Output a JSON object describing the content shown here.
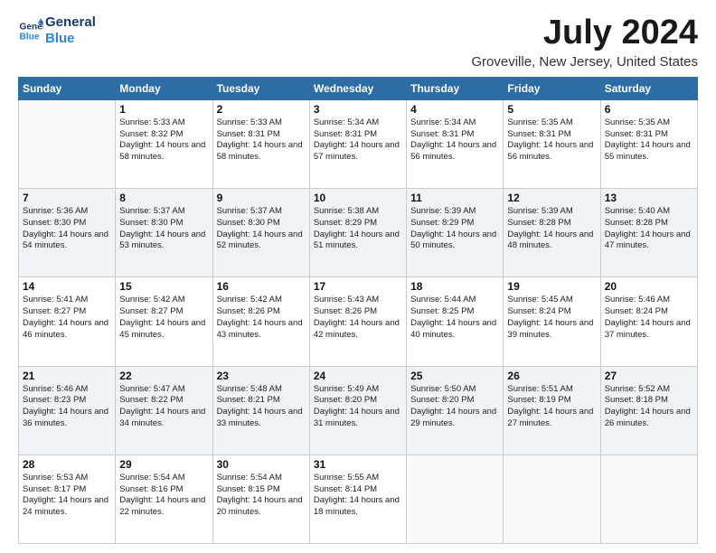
{
  "logo": {
    "line1": "General",
    "line2": "Blue"
  },
  "title": "July 2024",
  "location": "Groveville, New Jersey, United States",
  "weekdays": [
    "Sunday",
    "Monday",
    "Tuesday",
    "Wednesday",
    "Thursday",
    "Friday",
    "Saturday"
  ],
  "weeks": [
    [
      {
        "day": "",
        "sunrise": "",
        "sunset": "",
        "daylight": ""
      },
      {
        "day": "1",
        "sunrise": "Sunrise: 5:33 AM",
        "sunset": "Sunset: 8:32 PM",
        "daylight": "Daylight: 14 hours and 58 minutes."
      },
      {
        "day": "2",
        "sunrise": "Sunrise: 5:33 AM",
        "sunset": "Sunset: 8:31 PM",
        "daylight": "Daylight: 14 hours and 58 minutes."
      },
      {
        "day": "3",
        "sunrise": "Sunrise: 5:34 AM",
        "sunset": "Sunset: 8:31 PM",
        "daylight": "Daylight: 14 hours and 57 minutes."
      },
      {
        "day": "4",
        "sunrise": "Sunrise: 5:34 AM",
        "sunset": "Sunset: 8:31 PM",
        "daylight": "Daylight: 14 hours and 56 minutes."
      },
      {
        "day": "5",
        "sunrise": "Sunrise: 5:35 AM",
        "sunset": "Sunset: 8:31 PM",
        "daylight": "Daylight: 14 hours and 56 minutes."
      },
      {
        "day": "6",
        "sunrise": "Sunrise: 5:35 AM",
        "sunset": "Sunset: 8:31 PM",
        "daylight": "Daylight: 14 hours and 55 minutes."
      }
    ],
    [
      {
        "day": "7",
        "sunrise": "Sunrise: 5:36 AM",
        "sunset": "Sunset: 8:30 PM",
        "daylight": "Daylight: 14 hours and 54 minutes."
      },
      {
        "day": "8",
        "sunrise": "Sunrise: 5:37 AM",
        "sunset": "Sunset: 8:30 PM",
        "daylight": "Daylight: 14 hours and 53 minutes."
      },
      {
        "day": "9",
        "sunrise": "Sunrise: 5:37 AM",
        "sunset": "Sunset: 8:30 PM",
        "daylight": "Daylight: 14 hours and 52 minutes."
      },
      {
        "day": "10",
        "sunrise": "Sunrise: 5:38 AM",
        "sunset": "Sunset: 8:29 PM",
        "daylight": "Daylight: 14 hours and 51 minutes."
      },
      {
        "day": "11",
        "sunrise": "Sunrise: 5:39 AM",
        "sunset": "Sunset: 8:29 PM",
        "daylight": "Daylight: 14 hours and 50 minutes."
      },
      {
        "day": "12",
        "sunrise": "Sunrise: 5:39 AM",
        "sunset": "Sunset: 8:28 PM",
        "daylight": "Daylight: 14 hours and 48 minutes."
      },
      {
        "day": "13",
        "sunrise": "Sunrise: 5:40 AM",
        "sunset": "Sunset: 8:28 PM",
        "daylight": "Daylight: 14 hours and 47 minutes."
      }
    ],
    [
      {
        "day": "14",
        "sunrise": "Sunrise: 5:41 AM",
        "sunset": "Sunset: 8:27 PM",
        "daylight": "Daylight: 14 hours and 46 minutes."
      },
      {
        "day": "15",
        "sunrise": "Sunrise: 5:42 AM",
        "sunset": "Sunset: 8:27 PM",
        "daylight": "Daylight: 14 hours and 45 minutes."
      },
      {
        "day": "16",
        "sunrise": "Sunrise: 5:42 AM",
        "sunset": "Sunset: 8:26 PM",
        "daylight": "Daylight: 14 hours and 43 minutes."
      },
      {
        "day": "17",
        "sunrise": "Sunrise: 5:43 AM",
        "sunset": "Sunset: 8:26 PM",
        "daylight": "Daylight: 14 hours and 42 minutes."
      },
      {
        "day": "18",
        "sunrise": "Sunrise: 5:44 AM",
        "sunset": "Sunset: 8:25 PM",
        "daylight": "Daylight: 14 hours and 40 minutes."
      },
      {
        "day": "19",
        "sunrise": "Sunrise: 5:45 AM",
        "sunset": "Sunset: 8:24 PM",
        "daylight": "Daylight: 14 hours and 39 minutes."
      },
      {
        "day": "20",
        "sunrise": "Sunrise: 5:46 AM",
        "sunset": "Sunset: 8:24 PM",
        "daylight": "Daylight: 14 hours and 37 minutes."
      }
    ],
    [
      {
        "day": "21",
        "sunrise": "Sunrise: 5:46 AM",
        "sunset": "Sunset: 8:23 PM",
        "daylight": "Daylight: 14 hours and 36 minutes."
      },
      {
        "day": "22",
        "sunrise": "Sunrise: 5:47 AM",
        "sunset": "Sunset: 8:22 PM",
        "daylight": "Daylight: 14 hours and 34 minutes."
      },
      {
        "day": "23",
        "sunrise": "Sunrise: 5:48 AM",
        "sunset": "Sunset: 8:21 PM",
        "daylight": "Daylight: 14 hours and 33 minutes."
      },
      {
        "day": "24",
        "sunrise": "Sunrise: 5:49 AM",
        "sunset": "Sunset: 8:20 PM",
        "daylight": "Daylight: 14 hours and 31 minutes."
      },
      {
        "day": "25",
        "sunrise": "Sunrise: 5:50 AM",
        "sunset": "Sunset: 8:20 PM",
        "daylight": "Daylight: 14 hours and 29 minutes."
      },
      {
        "day": "26",
        "sunrise": "Sunrise: 5:51 AM",
        "sunset": "Sunset: 8:19 PM",
        "daylight": "Daylight: 14 hours and 27 minutes."
      },
      {
        "day": "27",
        "sunrise": "Sunrise: 5:52 AM",
        "sunset": "Sunset: 8:18 PM",
        "daylight": "Daylight: 14 hours and 26 minutes."
      }
    ],
    [
      {
        "day": "28",
        "sunrise": "Sunrise: 5:53 AM",
        "sunset": "Sunset: 8:17 PM",
        "daylight": "Daylight: 14 hours and 24 minutes."
      },
      {
        "day": "29",
        "sunrise": "Sunrise: 5:54 AM",
        "sunset": "Sunset: 8:16 PM",
        "daylight": "Daylight: 14 hours and 22 minutes."
      },
      {
        "day": "30",
        "sunrise": "Sunrise: 5:54 AM",
        "sunset": "Sunset: 8:15 PM",
        "daylight": "Daylight: 14 hours and 20 minutes."
      },
      {
        "day": "31",
        "sunrise": "Sunrise: 5:55 AM",
        "sunset": "Sunset: 8:14 PM",
        "daylight": "Daylight: 14 hours and 18 minutes."
      },
      {
        "day": "",
        "sunrise": "",
        "sunset": "",
        "daylight": ""
      },
      {
        "day": "",
        "sunrise": "",
        "sunset": "",
        "daylight": ""
      },
      {
        "day": "",
        "sunrise": "",
        "sunset": "",
        "daylight": ""
      }
    ]
  ]
}
